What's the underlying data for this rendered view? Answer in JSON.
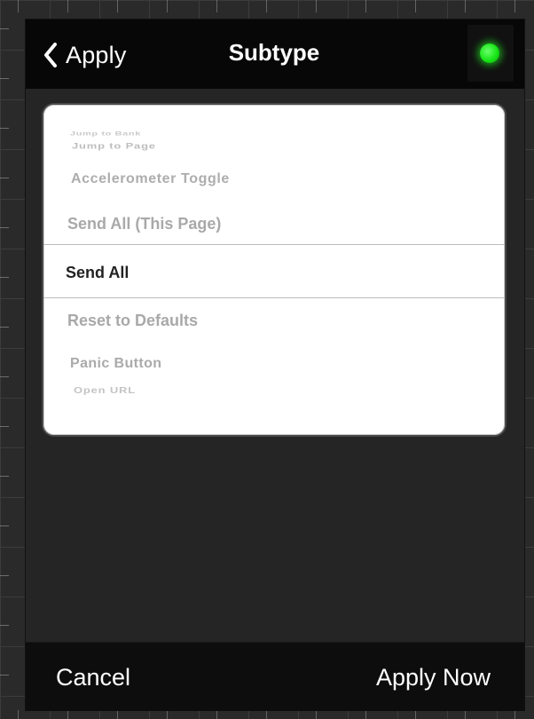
{
  "navbar": {
    "back_label": "Apply",
    "title": "Subtype",
    "back_icon": "chevron-left-icon",
    "status_indicator": {
      "icon": "status-led-icon",
      "color": "#17e617"
    }
  },
  "picker": {
    "rows": [
      "Jump to Page",
      "Accelerometer Toggle",
      "Send All (This Page)",
      "Send All",
      "Reset to Defaults",
      "Panic Button",
      "Open URL"
    ],
    "selected": "Send All"
  },
  "toolbar": {
    "cancel_label": "Cancel",
    "apply_now_label": "Apply Now"
  },
  "colors": {
    "background": "#2a2a2a",
    "navbar": "#070707",
    "picker": "#ffffff",
    "selected_text": "#222222",
    "dim_text": "#a9a9a9"
  }
}
